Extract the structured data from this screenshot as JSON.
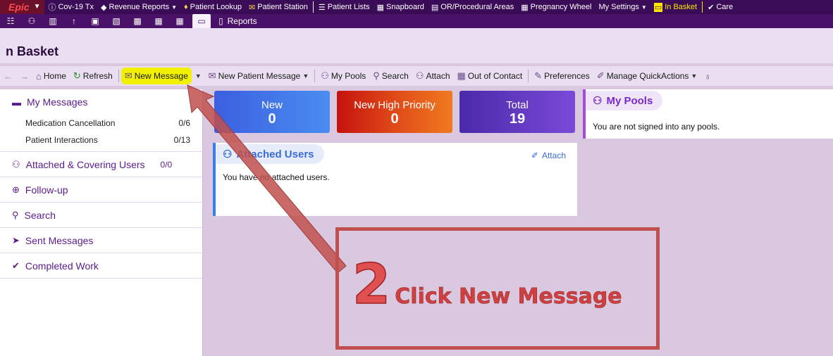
{
  "topbar": {
    "logo": "Epic",
    "items": [
      {
        "icon": "info-circle-icon",
        "glyph": "ⓘ",
        "label": "Cov-19 Tx"
      },
      {
        "icon": "diamond-icon",
        "glyph": "◆",
        "label": "Revenue Reports",
        "dropdown": true
      },
      {
        "icon": "person-icon",
        "glyph": "♦",
        "label": "Patient Lookup"
      },
      {
        "icon": "patient-station-icon",
        "glyph": "✉",
        "label": "Patient Station"
      },
      {
        "icon": "patient-lists-icon",
        "glyph": "☰",
        "label": "Patient Lists"
      },
      {
        "icon": "snapboard-icon",
        "glyph": "▦",
        "label": "Snapboard"
      },
      {
        "icon": "or-areas-icon",
        "glyph": "▤",
        "label": "OR/Procedural Areas"
      },
      {
        "icon": "calendar-icon",
        "glyph": "▦",
        "label": "Pregnancy Wheel"
      },
      {
        "icon": "",
        "glyph": "",
        "label": "My Settings",
        "dropdown": true
      },
      {
        "icon": "in-basket-icon",
        "glyph": "▭",
        "label": "In Basket",
        "active": true
      },
      {
        "icon": "check-icon",
        "glyph": "✔",
        "label": "Care"
      }
    ]
  },
  "iconbar": {
    "reports_label": "Reports"
  },
  "page": {
    "title": "n Basket"
  },
  "toolbar": {
    "back_glyph": "←",
    "forward_glyph": "→",
    "home": "Home",
    "refresh": "Refresh",
    "new_message": "New Message",
    "new_patient_message": "New Patient Message",
    "my_pools": "My Pools",
    "search": "Search",
    "attach": "Attach",
    "out_of_contact": "Out of Contact",
    "preferences": "Preferences",
    "manage_quickactions": "Manage QuickActions"
  },
  "sidebar": {
    "my_messages": {
      "label": "My Messages",
      "items": [
        {
          "label": "Medication Cancellation",
          "count": "0/6"
        },
        {
          "label": "Patient Interactions",
          "count": "0/13"
        }
      ]
    },
    "attached_covering": {
      "label": "Attached & Covering Users",
      "count": "0/0"
    },
    "follow_up": {
      "label": "Follow-up"
    },
    "search": {
      "label": "Search"
    },
    "sent_messages": {
      "label": "Sent Messages"
    },
    "completed_work": {
      "label": "Completed Work"
    }
  },
  "stats": {
    "new": {
      "label": "New",
      "value": "0"
    },
    "high_priority": {
      "label": "New High Priority",
      "value": "0"
    },
    "total": {
      "label": "Total",
      "value": "19"
    }
  },
  "attached_users": {
    "title": "Attached Users",
    "action": "Attach",
    "message": "You have no attached users."
  },
  "my_pools": {
    "title": "My Pools",
    "message": "You are not signed into any pools."
  },
  "callout": {
    "step": "2",
    "text": "Click New Message"
  },
  "colors": {
    "highlight": "#f0f000",
    "callout": "#c0504d",
    "brand": "#3a0c57"
  }
}
